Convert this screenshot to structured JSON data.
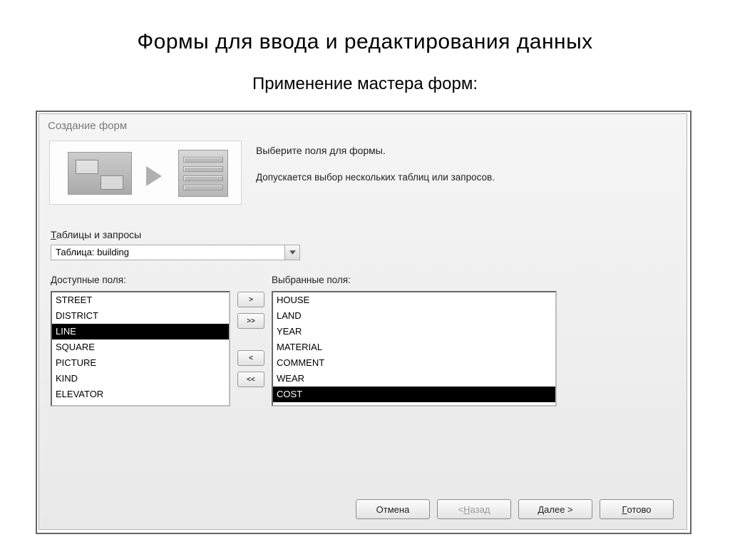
{
  "page": {
    "title": "Формы для ввода и редактирования данных",
    "subtitle": "Применение мастера форм:"
  },
  "dialog": {
    "title": "Создание форм",
    "instruction1": "Выберите поля для формы.",
    "instruction2": "Допускается выбор нескольких таблиц или запросов.",
    "tables_label_pre": "Т",
    "tables_label_rest": "аблицы и запросы",
    "combo_value": "Таблица: building",
    "available_label": "Доступные поля:",
    "selected_label": "Выбранные поля:",
    "available": [
      {
        "label": "STREET",
        "selected": false
      },
      {
        "label": "DISTRICT",
        "selected": false
      },
      {
        "label": "LINE",
        "selected": true
      },
      {
        "label": "SQUARE",
        "selected": false
      },
      {
        "label": "PICTURE",
        "selected": false
      },
      {
        "label": "KIND",
        "selected": false
      },
      {
        "label": "ELEVATOR",
        "selected": false
      }
    ],
    "chosen": [
      {
        "label": "HOUSE",
        "selected": false
      },
      {
        "label": "LAND",
        "selected": false
      },
      {
        "label": "YEAR",
        "selected": false
      },
      {
        "label": "MATERIAL",
        "selected": false
      },
      {
        "label": "COMMENT",
        "selected": false
      },
      {
        "label": "WEAR",
        "selected": false
      },
      {
        "label": "COST",
        "selected": true
      }
    ],
    "btn_add": ">",
    "btn_add_all": ">>",
    "btn_remove": "<",
    "btn_remove_all": "<<",
    "btn_cancel": "Отмена",
    "btn_back_lt": "< ",
    "btn_back_u": "Н",
    "btn_back_rest": "азад",
    "btn_next_u": "Д",
    "btn_next_rest": "алее >",
    "btn_finish_u": "Г",
    "btn_finish_rest": "отово"
  }
}
